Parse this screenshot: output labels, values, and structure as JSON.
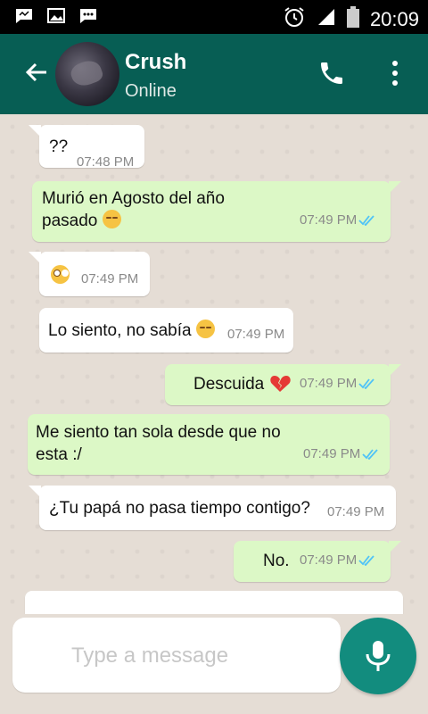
{
  "status_bar": {
    "time": "20:09",
    "icons": [
      "chat-notification-icon",
      "image-notification-icon",
      "message-notification-icon",
      "alarm-icon",
      "signal-icon",
      "battery-icon"
    ]
  },
  "header": {
    "title": "Crush",
    "status": "Online",
    "icons": [
      "back-arrow-icon",
      "call-icon",
      "more-options-icon"
    ]
  },
  "messages": [
    {
      "id": 1,
      "direction": "in",
      "text": "??",
      "emoji": "",
      "time": "07:48 PM",
      "read": false
    },
    {
      "id": 2,
      "direction": "out",
      "line1": "Murió en Agosto del año",
      "line2": "pasado",
      "emoji": "pensive",
      "time": "07:49 PM",
      "read": true
    },
    {
      "id": 3,
      "direction": "in",
      "text": "",
      "emoji": "flushed",
      "time": "07:49 PM",
      "read": false
    },
    {
      "id": 4,
      "direction": "in",
      "text": "Lo siento, no sabía",
      "emoji": "pensive",
      "time": "07:49 PM",
      "read": false
    },
    {
      "id": 5,
      "direction": "out",
      "text": "Descuida",
      "emoji": "broken-heart",
      "time": "07:49 PM",
      "read": true
    },
    {
      "id": 6,
      "direction": "out",
      "line1": "Me siento tan sola desde que no",
      "line2": "esta :/",
      "emoji": "",
      "time": "07:49 PM",
      "read": true
    },
    {
      "id": 7,
      "direction": "in",
      "text": "¿Tu papá no pasa tiempo contigo?",
      "emoji": "",
      "time": "07:49 PM",
      "read": false
    },
    {
      "id": 8,
      "direction": "out",
      "text": "No.",
      "emoji": "",
      "time": "07:49 PM",
      "read": true
    }
  ],
  "composer": {
    "placeholder": "Type a message",
    "value": ""
  },
  "colors": {
    "header": "#075e54",
    "incoming": "#ffffff",
    "outgoing": "#dcf8c6",
    "mic_button": "#128c7e",
    "read_ticks": "#4fc3f7",
    "background": "#e5ddd5"
  }
}
